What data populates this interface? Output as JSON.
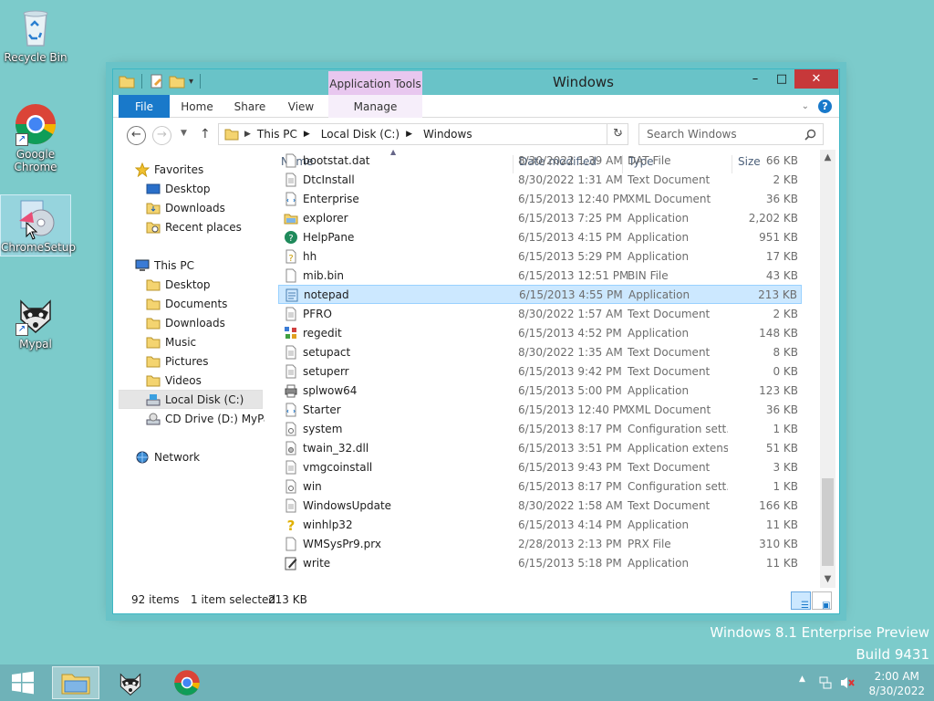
{
  "desktop": {
    "icons": [
      {
        "label": "Recycle Bin"
      },
      {
        "label": "Google Chrome"
      },
      {
        "label": "ChromeSetup"
      },
      {
        "label": "Mypal"
      }
    ]
  },
  "window": {
    "title": "Windows",
    "contextual_tab_group": "Application Tools",
    "tabs": {
      "file": "File",
      "home": "Home",
      "share": "Share",
      "view": "View",
      "manage": "Manage"
    },
    "help": "?",
    "controls": {
      "minimize": "–",
      "maximize": "□",
      "close": "✕"
    }
  },
  "address": {
    "back": "←",
    "forward": "→",
    "up": "↑",
    "crumbs": [
      "This PC",
      "Local Disk (C:)",
      "Windows"
    ],
    "search_placeholder": "Search Windows"
  },
  "nav": {
    "favorites_label": "Favorites",
    "favorites": [
      "Desktop",
      "Downloads",
      "Recent places"
    ],
    "thispc_label": "This PC",
    "thispc": [
      "Desktop",
      "Documents",
      "Downloads",
      "Music",
      "Pictures",
      "Videos",
      "Local Disk (C:)",
      "CD Drive (D:) MyPal"
    ],
    "network_label": "Network"
  },
  "columns": {
    "name": "Name",
    "date": "Date modified",
    "type": "Type",
    "size": "Size"
  },
  "files": [
    {
      "name": "bootstat.dat",
      "date": "8/30/2022 1:39 AM",
      "type": "DAT File",
      "size": "66 KB",
      "icon": "file-icon"
    },
    {
      "name": "DtcInstall",
      "date": "8/30/2022 1:31 AM",
      "type": "Text Document",
      "size": "2 KB",
      "icon": "text-file-icon"
    },
    {
      "name": "Enterprise",
      "date": "6/15/2013 12:40 PM",
      "type": "XML Document",
      "size": "36 KB",
      "icon": "xml-file-icon"
    },
    {
      "name": "explorer",
      "date": "6/15/2013 7:25 PM",
      "type": "Application",
      "size": "2,202 KB",
      "icon": "folder-app-icon"
    },
    {
      "name": "HelpPane",
      "date": "6/15/2013 4:15 PM",
      "type": "Application",
      "size": "951 KB",
      "icon": "help-icon"
    },
    {
      "name": "hh",
      "date": "6/15/2013 5:29 PM",
      "type": "Application",
      "size": "17 KB",
      "icon": "help-doc-icon"
    },
    {
      "name": "mib.bin",
      "date": "6/15/2013 12:51 PM",
      "type": "BIN File",
      "size": "43 KB",
      "icon": "file-icon"
    },
    {
      "name": "notepad",
      "date": "6/15/2013 4:55 PM",
      "type": "Application",
      "size": "213 KB",
      "icon": "notepad-icon"
    },
    {
      "name": "PFRO",
      "date": "8/30/2022 1:57 AM",
      "type": "Text Document",
      "size": "2 KB",
      "icon": "text-file-icon"
    },
    {
      "name": "regedit",
      "date": "6/15/2013 4:52 PM",
      "type": "Application",
      "size": "148 KB",
      "icon": "regedit-icon"
    },
    {
      "name": "setupact",
      "date": "8/30/2022 1:35 AM",
      "type": "Text Document",
      "size": "8 KB",
      "icon": "text-file-icon"
    },
    {
      "name": "setuperr",
      "date": "6/15/2013 9:42 PM",
      "type": "Text Document",
      "size": "0 KB",
      "icon": "text-file-icon"
    },
    {
      "name": "splwow64",
      "date": "6/15/2013 5:00 PM",
      "type": "Application",
      "size": "123 KB",
      "icon": "printer-icon"
    },
    {
      "name": "Starter",
      "date": "6/15/2013 12:40 PM",
      "type": "XML Document",
      "size": "36 KB",
      "icon": "xml-file-icon"
    },
    {
      "name": "system",
      "date": "6/15/2013 8:17 PM",
      "type": "Configuration sett...",
      "size": "1 KB",
      "icon": "config-file-icon"
    },
    {
      "name": "twain_32.dll",
      "date": "6/15/2013 3:51 PM",
      "type": "Application extens...",
      "size": "51 KB",
      "icon": "dll-file-icon"
    },
    {
      "name": "vmgcoinstall",
      "date": "6/15/2013 9:43 PM",
      "type": "Text Document",
      "size": "3 KB",
      "icon": "text-file-icon"
    },
    {
      "name": "win",
      "date": "6/15/2013 8:17 PM",
      "type": "Configuration sett...",
      "size": "1 KB",
      "icon": "config-file-icon"
    },
    {
      "name": "WindowsUpdate",
      "date": "8/30/2022 1:58 AM",
      "type": "Text Document",
      "size": "166 KB",
      "icon": "text-file-icon"
    },
    {
      "name": "winhlp32",
      "date": "6/15/2013 4:14 PM",
      "type": "Application",
      "size": "11 KB",
      "icon": "help-question-icon"
    },
    {
      "name": "WMSysPr9.prx",
      "date": "2/28/2013 2:13 PM",
      "type": "PRX File",
      "size": "310 KB",
      "icon": "file-icon"
    },
    {
      "name": "write",
      "date": "6/15/2013 5:18 PM",
      "type": "Application",
      "size": "11 KB",
      "icon": "write-icon"
    }
  ],
  "selected_row_index": 7,
  "status": {
    "count": "92 items",
    "selection": "1 item selected",
    "size": "213 KB"
  },
  "watermark": {
    "line1": "Windows 8.1 Enterprise Preview",
    "line2": "Build 9431"
  },
  "clock": {
    "time": "2:00 AM",
    "date": "8/30/2022"
  },
  "colors": {
    "accent": "#1979ca",
    "titlebar": "#69c3c8",
    "desktop": "#7ccbcb",
    "selection": "#cce8ff",
    "close": "#c7383a"
  }
}
